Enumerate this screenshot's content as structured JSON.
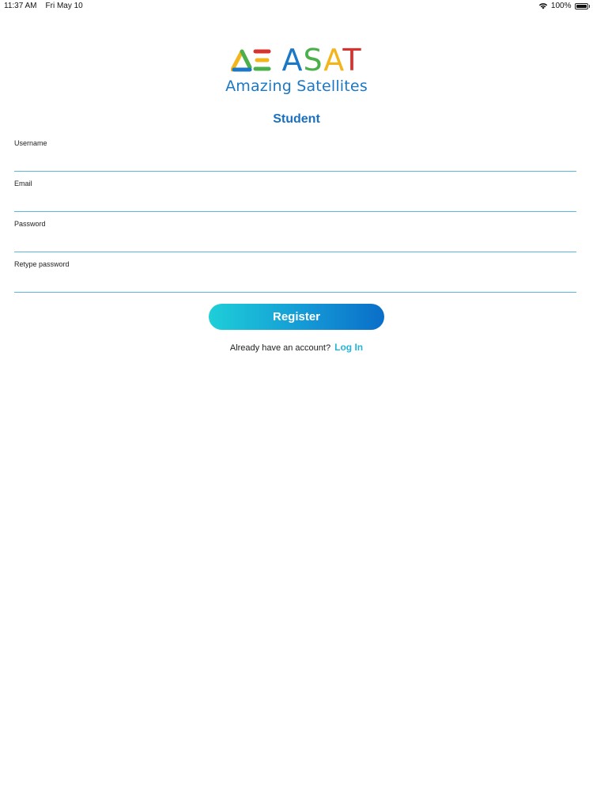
{
  "status_bar": {
    "time": "11:37 AM",
    "date": "Fri May 10",
    "battery": "100%"
  },
  "logo": {
    "name_letters": [
      "A",
      "S",
      "A",
      "T"
    ],
    "tagline": "Amazing Satellites"
  },
  "role_title": "Student",
  "form": {
    "username_label": "Username",
    "email_label": "Email",
    "password_label": "Password",
    "retype_label": "Retype password"
  },
  "register_label": "Register",
  "login_prompt": "Already have an account?",
  "login_link": "Log In",
  "colors": {
    "accent_blue": "#1a70c0",
    "field_underline": "#5bb5dc",
    "link": "#25b4d7"
  }
}
